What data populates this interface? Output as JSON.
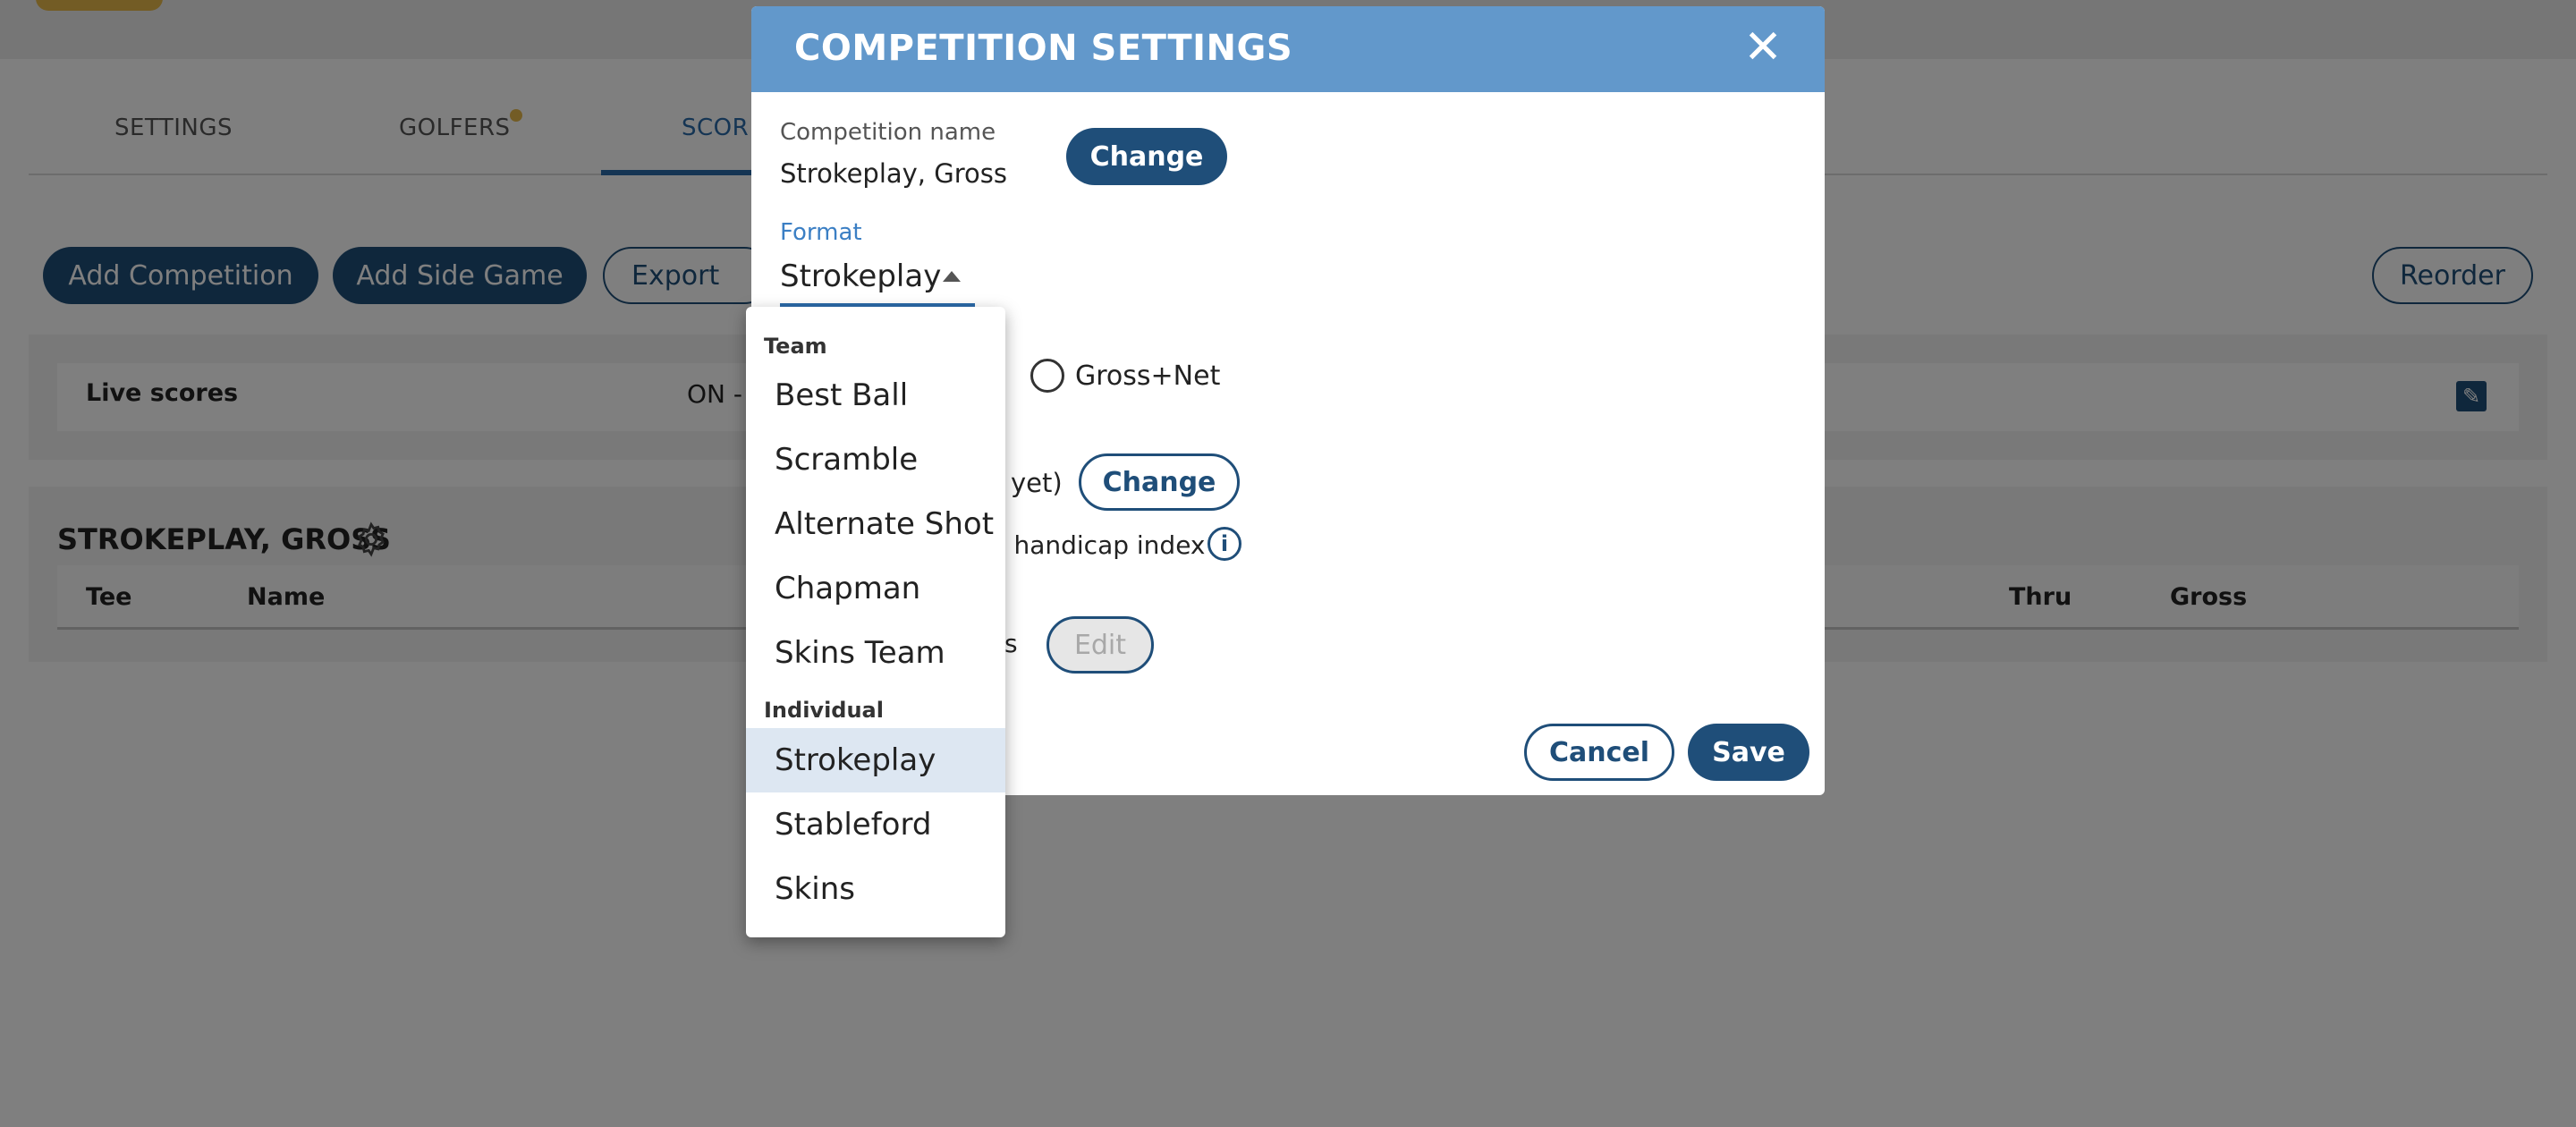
{
  "tabs": [
    "SETTINGS",
    "GOLFERS",
    "SCOR"
  ],
  "toolbar": {
    "add_competition": "Add Competition",
    "add_side_game": "Add Side Game",
    "export": "Export",
    "reorder": "Reorder"
  },
  "live": {
    "label": "Live scores",
    "value": "ON -"
  },
  "section": {
    "title": "STROKEPLAY, GROSS",
    "columns": [
      "Tee",
      "Name",
      "Thru",
      "Gross"
    ]
  },
  "modal": {
    "title": "COMPETITION SETTINGS",
    "close_icon": "close-icon",
    "name_label": "Competition name",
    "name_value": "Strokeplay, Gross",
    "change_label": "Change",
    "format_label": "Format",
    "format_value": "Strokeplay",
    "radio_gross_net": "Gross+Net",
    "partial_yet": "yet)",
    "change2_label": "Change",
    "partial_handicap": "y handicap index",
    "info_icon": "i",
    "partial_ts": "ts",
    "edit_label": "Edit",
    "cancel_label": "Cancel",
    "save_label": "Save"
  },
  "dropdown": {
    "team_header": "Team",
    "team_options": [
      "Best Ball",
      "Scramble",
      "Alternate Shot",
      "Chapman",
      "Skins Team"
    ],
    "individual_header": "Individual",
    "individual_options": [
      "Strokeplay",
      "Stableford",
      "Skins"
    ],
    "selected": "Strokeplay"
  },
  "colors": {
    "primary": "#1f4e79",
    "header_blue": "#6298cb",
    "accent_yellow": "#e6b84a",
    "selected_bg": "#dde7f2"
  }
}
